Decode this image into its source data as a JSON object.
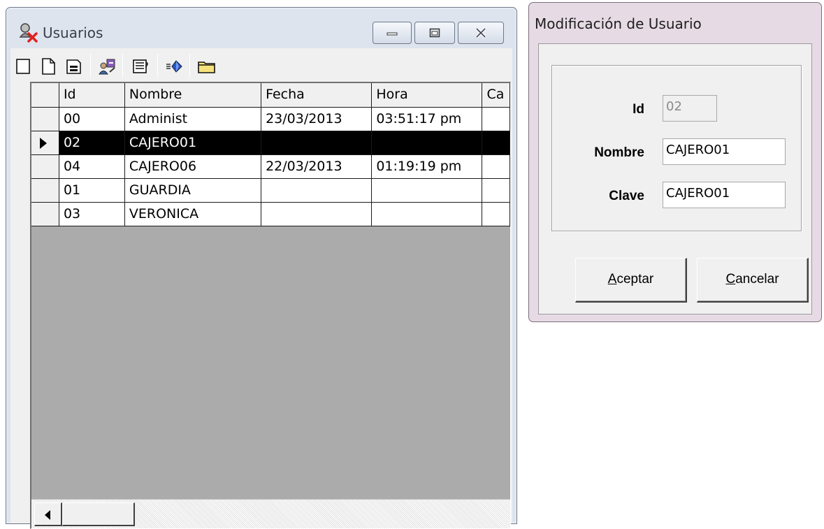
{
  "users_window": {
    "title": "Usuarios",
    "toolbar": [
      "new-icon",
      "document-icon",
      "save-icon",
      "users-key-icon",
      "list-icon",
      "export-icon",
      "folder-icon"
    ],
    "grid": {
      "columns": [
        "Id",
        "Nombre",
        "Fecha",
        "Hora",
        "Ca"
      ],
      "rows": [
        {
          "id": "00",
          "nombre": "Administ",
          "fecha": "23/03/2013",
          "hora": "03:51:17 pm",
          "selected": false
        },
        {
          "id": "02",
          "nombre": "CAJERO01",
          "fecha": "",
          "hora": "",
          "selected": true
        },
        {
          "id": "04",
          "nombre": "CAJERO06",
          "fecha": "22/03/2013",
          "hora": "01:19:19 pm",
          "selected": false
        },
        {
          "id": "01",
          "nombre": "GUARDIA",
          "fecha": "",
          "hora": "",
          "selected": false
        },
        {
          "id": "03",
          "nombre": "VERONICA",
          "fecha": "",
          "hora": "",
          "selected": false
        }
      ]
    }
  },
  "dialog": {
    "title": "Modificación de Usuario",
    "fields": {
      "id": {
        "label": "Id",
        "value": "02"
      },
      "nombre": {
        "label": "Nombre",
        "value": "CAJERO01"
      },
      "clave": {
        "label": "Clave",
        "value": "CAJERO01"
      }
    },
    "buttons": {
      "aceptar": {
        "accel": "A",
        "rest": "ceptar"
      },
      "cancelar": {
        "accel": "C",
        "rest": "ancelar"
      }
    }
  },
  "colors": {
    "selected_row_bg": "#000000",
    "selected_row_fg": "#ffffff",
    "users_frame": "#dde4ee",
    "dialog_frame": "#e6dbe5"
  }
}
